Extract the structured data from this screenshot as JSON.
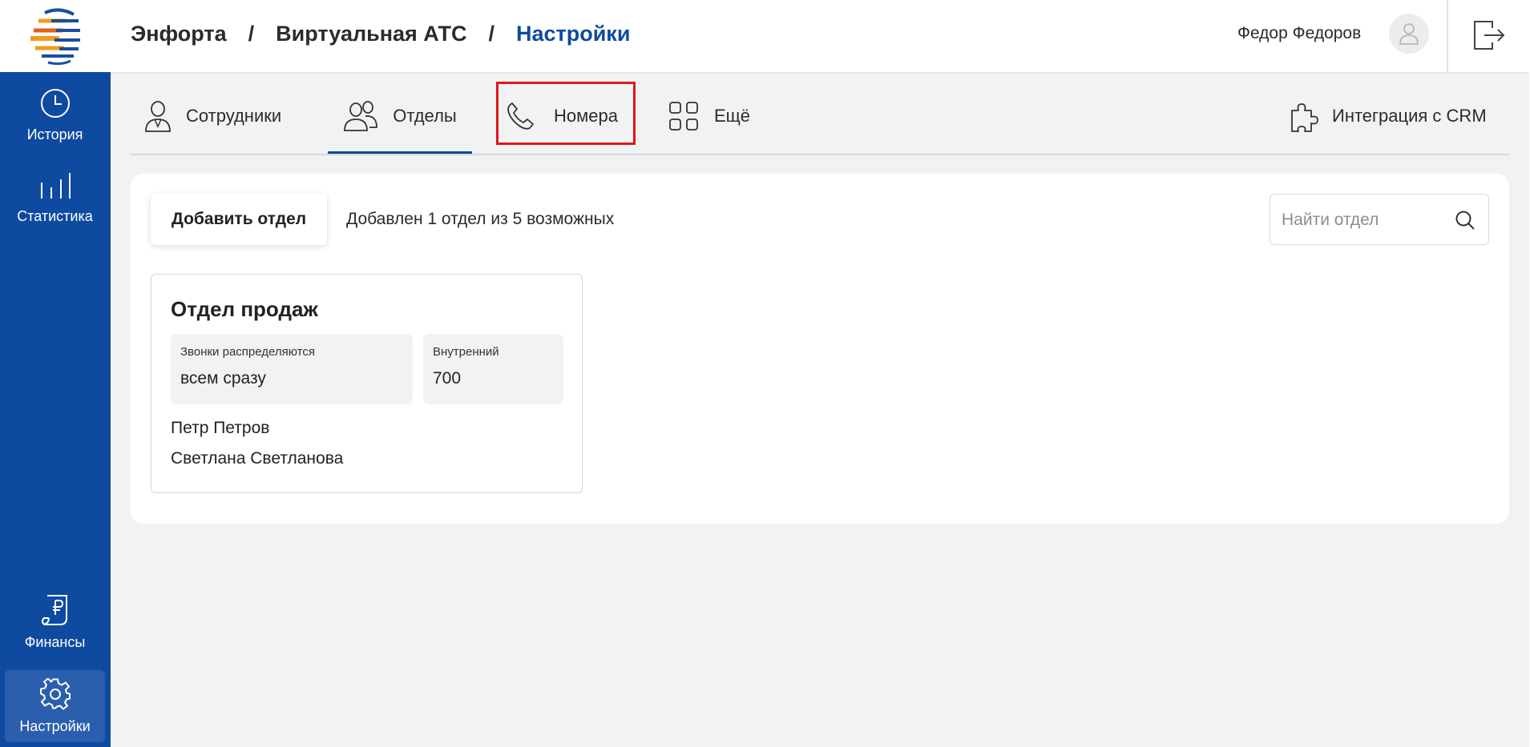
{
  "breadcrumb": {
    "items": [
      "Энфорта",
      "Виртуальная АТС",
      "Настройки"
    ],
    "separator": "/"
  },
  "user": {
    "name": "Федор Федоров"
  },
  "sidebar": {
    "items": [
      {
        "label": "История",
        "icon": "clock-icon"
      },
      {
        "label": "Статистика",
        "icon": "bar-chart-icon"
      },
      {
        "label": "Финансы",
        "icon": "ruble-document-icon"
      },
      {
        "label": "Настройки",
        "icon": "gear-icon",
        "active": true
      }
    ]
  },
  "tabs": {
    "items": [
      {
        "label": "Сотрудники",
        "icon": "person-icon"
      },
      {
        "label": "Отделы",
        "icon": "people-icon",
        "active": true
      },
      {
        "label": "Номера",
        "icon": "phone-icon"
      },
      {
        "label": "Ещё",
        "icon": "grid-icon"
      }
    ],
    "crm": {
      "label": "Интеграция с CRM",
      "icon": "puzzle-icon"
    }
  },
  "toolbar": {
    "add_label": "Добавить отдел",
    "count_text": "Добавлен 1 отдел из 5 возможных",
    "search_placeholder": "Найти отдел"
  },
  "department": {
    "title": "Отдел продаж",
    "distribution_label": "Звонки распределяются",
    "distribution_value": "всем сразу",
    "internal_label": "Внутренний",
    "internal_value": "700",
    "members": [
      "Петр Петров",
      "Светлана Светланова"
    ]
  },
  "colors": {
    "brand": "#0f4aa1",
    "highlight": "#e3141b",
    "background": "#f1f2f2"
  }
}
